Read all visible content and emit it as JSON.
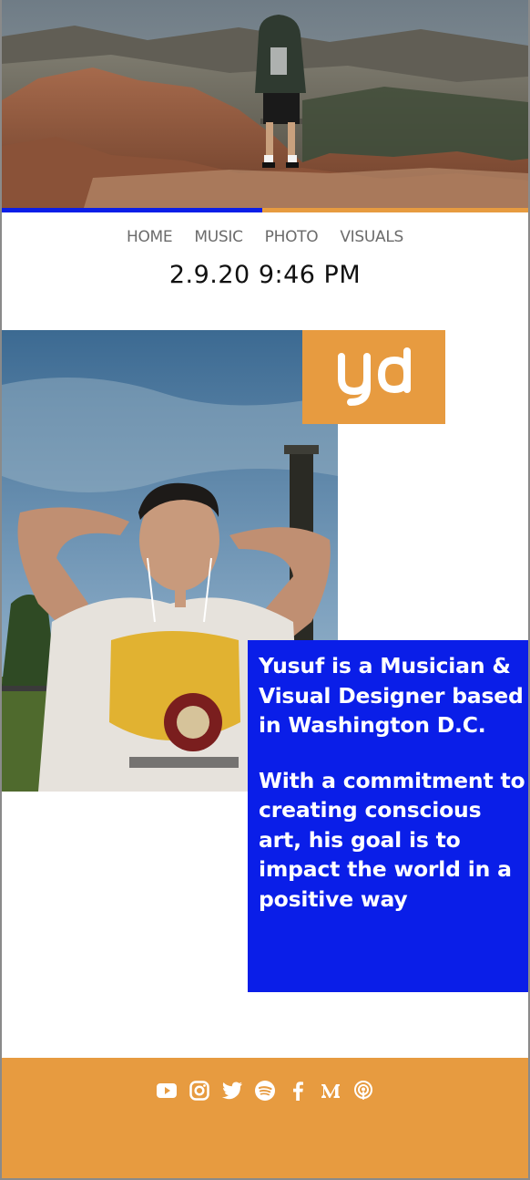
{
  "nav": {
    "items": [
      "HOME",
      "MUSIC",
      "PHOTO",
      "VISUALS"
    ]
  },
  "datetime": "2.9.20 9:46 PM",
  "logo": {
    "text": "yd",
    "background": "#e79b40"
  },
  "bio": {
    "paragraph_1": "Yusuf is a Musician & Visual Designer based in Washington D.C.",
    "paragraph_2": "With a commitment to creating conscious art, his goal is to impact the world in a positive way",
    "background": "#0a1ee8"
  },
  "colors": {
    "accent_blue": "#0a1ee8",
    "accent_orange": "#e79b40",
    "footer": "#e79b40"
  },
  "social_icons": [
    "youtube-icon",
    "instagram-icon",
    "twitter-icon",
    "spotify-icon",
    "facebook-icon",
    "medium-icon",
    "podcast-icon"
  ]
}
